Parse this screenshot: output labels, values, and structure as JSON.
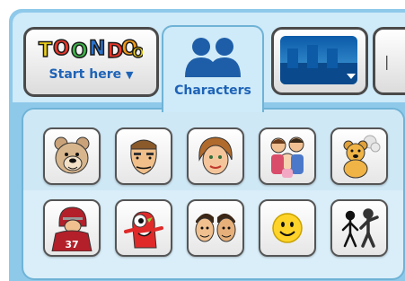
{
  "toolbar": {
    "start_button": {
      "logo_text": "TOONDOO",
      "label": "Start here",
      "arrow": "▼"
    },
    "characters_tab": {
      "label": "Characters",
      "icon": "people-icon"
    },
    "background_button": {
      "icon": "background-thumbnail",
      "arrow": "▼"
    }
  },
  "characters": [
    {
      "name": "bear-character",
      "icon": "bear-face"
    },
    {
      "name": "tough-guy-character",
      "icon": "man-face"
    },
    {
      "name": "woman-character",
      "icon": "woman-face"
    },
    {
      "name": "family-character",
      "icon": "family-group"
    },
    {
      "name": "teddy-bear-character",
      "icon": "teddy-bear"
    },
    {
      "name": "football-player-character",
      "icon": "football-player",
      "jersey_number": "37"
    },
    {
      "name": "red-monster-character",
      "icon": "red-monster"
    },
    {
      "name": "two-faces-character",
      "icon": "two-faces"
    },
    {
      "name": "smiley-character",
      "icon": "smiley-face"
    },
    {
      "name": "stick-figures-character",
      "icon": "stick-figures"
    }
  ],
  "colors": {
    "app_background": "#8ec9ea",
    "panel": "#d9eef9",
    "label_blue": "#1e63b7",
    "button_border": "#4a4a4a"
  }
}
